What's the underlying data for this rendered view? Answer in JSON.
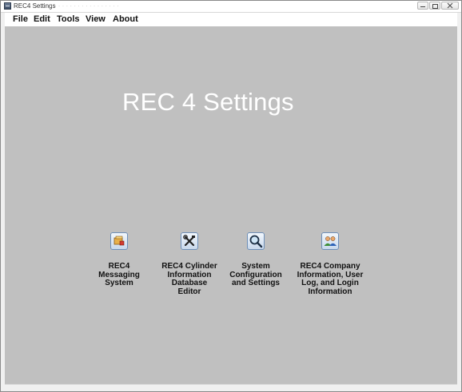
{
  "window": {
    "title": "REC4 Settings",
    "title_ghost": "· · · · · · · · · · · · · · · · · ·"
  },
  "menu": {
    "file": "File",
    "edit": "Edit",
    "tools": "Tools",
    "view": "View",
    "about": "About"
  },
  "main": {
    "heading": "REC 4 Settings",
    "launchers": [
      {
        "icon": "messaging-icon",
        "label_lines": [
          "REC4",
          "Messaging",
          "System"
        ]
      },
      {
        "icon": "tools-icon",
        "label_lines": [
          "REC4 Cylinder",
          "Information",
          "Database",
          "Editor"
        ]
      },
      {
        "icon": "magnifier-icon",
        "label_lines": [
          "System",
          "Configuration",
          "and Settings"
        ]
      },
      {
        "icon": "users-icon",
        "label_lines": [
          "REC4 Company",
          "Information, User",
          "Log, and Login",
          "Information"
        ]
      }
    ]
  },
  "colors": {
    "background": "#c0c0c0",
    "heading": "#ffffff",
    "menubar": "#ffffff"
  }
}
